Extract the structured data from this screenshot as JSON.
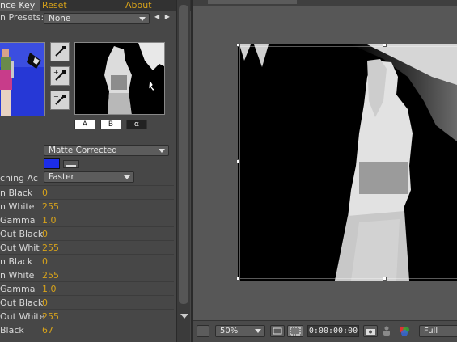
{
  "effect_panel": {
    "tab_title": "nce Key",
    "reset_label": "Reset",
    "about_label": "About",
    "presets_label": "n Presets:",
    "presets_value": "None",
    "view_buttons": [
      "A",
      "B",
      "α"
    ],
    "output_value": "Matte Corrected",
    "key_color": "#1c2de8",
    "matching_label": "ching Ac",
    "matching_value": "Faster",
    "properties": [
      {
        "label": "n Black",
        "value": "0"
      },
      {
        "label": "n White",
        "value": "255"
      },
      {
        "label": "Gamma",
        "value": "1.0"
      },
      {
        "label": "Out Black",
        "value": "0"
      },
      {
        "label": "Out Whit",
        "value": "255"
      },
      {
        "label": "n Black",
        "value": "0"
      },
      {
        "label": "n White",
        "value": "255"
      },
      {
        "label": "Gamma",
        "value": "1.0"
      },
      {
        "label": "Out Black",
        "value": "0"
      },
      {
        "label": "Out White",
        "value": "255"
      },
      {
        "label": "Black",
        "value": "67"
      }
    ]
  },
  "monitor": {
    "zoom": "50%",
    "timecode": "0:00:00:00",
    "quality": "Full"
  }
}
